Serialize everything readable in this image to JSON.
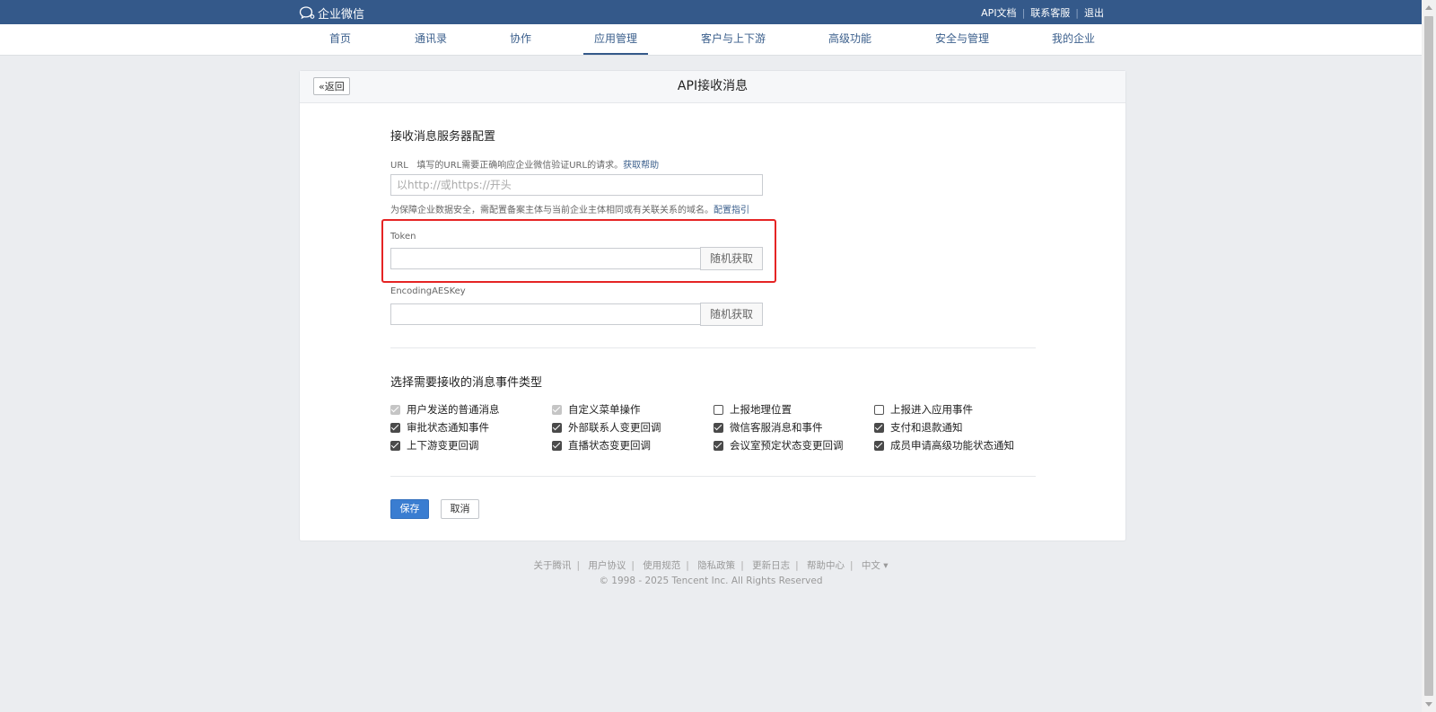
{
  "topbar": {
    "logo_text": "企业微信",
    "links": [
      "API文档",
      "联系客服",
      "退出"
    ]
  },
  "nav": {
    "items": [
      "首页",
      "通讯录",
      "协作",
      "应用管理",
      "客户与上下游",
      "高级功能",
      "安全与管理",
      "我的企业"
    ],
    "active": "应用管理"
  },
  "card": {
    "back_label": "返回",
    "title": "API接收消息"
  },
  "server_config": {
    "title": "接收消息服务器配置",
    "url_label": "URL",
    "url_hint": "填写的URL需要正确响应企业微信验证URL的请求。",
    "url_help_link": "获取帮助",
    "url_placeholder": "以http://或https://开头",
    "security_note": "为保障企业数据安全，需配置备案主体与当前企业主体相同或有关联关系的域名。",
    "security_link": "配置指引",
    "token_label": "Token",
    "token_value": "",
    "token_random_button": "随机获取",
    "aeskey_label": "EncodingAESKey",
    "aeskey_value": "",
    "aeskey_random_button": "随机获取"
  },
  "events": {
    "title": "选择需要接收的消息事件类型",
    "items": [
      {
        "label": "用户发送的普通消息",
        "state": "checked-disabled"
      },
      {
        "label": "自定义菜单操作",
        "state": "checked-disabled"
      },
      {
        "label": "上报地理位置",
        "state": "unchecked"
      },
      {
        "label": "上报进入应用事件",
        "state": "unchecked"
      },
      {
        "label": "审批状态通知事件",
        "state": "checked"
      },
      {
        "label": "外部联系人变更回调",
        "state": "checked"
      },
      {
        "label": "微信客服消息和事件",
        "state": "checked"
      },
      {
        "label": "支付和退款通知",
        "state": "checked"
      },
      {
        "label": "上下游变更回调",
        "state": "checked"
      },
      {
        "label": "直播状态变更回调",
        "state": "checked"
      },
      {
        "label": "会议室预定状态变更回调",
        "state": "checked"
      },
      {
        "label": "成员申请高级功能状态通知",
        "state": "checked"
      }
    ]
  },
  "actions": {
    "save": "保存",
    "cancel": "取消"
  },
  "footer": {
    "links": [
      "关于腾讯",
      "用户协议",
      "使用规范",
      "隐私政策",
      "更新日志",
      "帮助中心"
    ],
    "language": "中文 ▾",
    "copyright": "© 1998 - 2025 Tencent Inc. All Rights Reserved"
  },
  "colors": {
    "brand": "#34598a",
    "primary_button": "#3a7dd1",
    "highlight": "#e52424"
  }
}
